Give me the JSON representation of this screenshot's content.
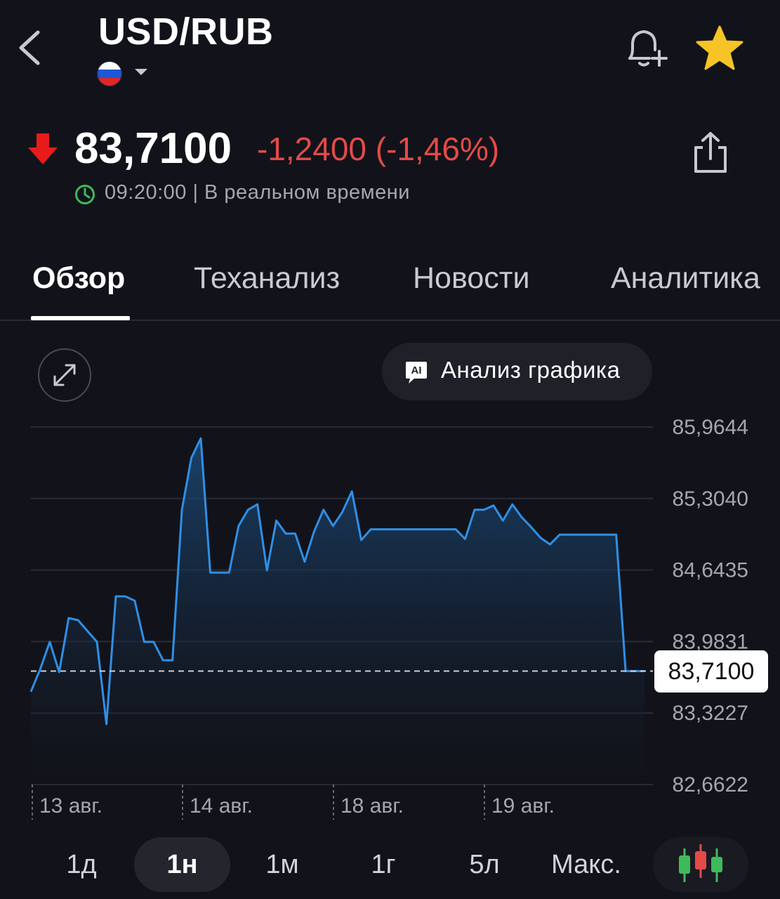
{
  "header": {
    "pair": "USD/RUB",
    "flag_colors": [
      "#ffffff",
      "#1c57d6",
      "#e1262a"
    ],
    "icons": [
      "back-chevron-icon",
      "bell-plus-icon",
      "star-icon"
    ],
    "star_color": "#f6c426"
  },
  "quote": {
    "price": "83,7100",
    "change": "-1,2400 (-1,46%)",
    "direction": "down",
    "down_color": "#e34b48",
    "arrow_color": "#e81b1b",
    "time_status": "09:20:00 | В реальном времени",
    "clock_color": "#3fba5b"
  },
  "tabs": [
    {
      "label": "Обзор",
      "active": true
    },
    {
      "label": "Теханализ",
      "active": false
    },
    {
      "label": "Новости",
      "active": false
    },
    {
      "label": "Аналитика",
      "active": false
    }
  ],
  "chart_controls": {
    "ai_label": "Анализ графика",
    "ai_icon_text": "AI"
  },
  "chart_data": {
    "type": "area",
    "y_ticks": [
      "85,9644",
      "85,3040",
      "84,6435",
      "83,9831",
      "83,3227",
      "82,6622"
    ],
    "y_tick_values": [
      85.9644,
      85.304,
      84.6435,
      83.9831,
      83.3227,
      82.6622
    ],
    "ylim": [
      82.6622,
      85.9644
    ],
    "x_ticks": [
      "13 авг.",
      "14 авг.",
      "18 авг.",
      "19 авг."
    ],
    "current_value": 83.71,
    "current_label": "83,7100",
    "line_color": "#2f8fe6",
    "grid": true,
    "values": [
      83.52,
      83.73,
      83.98,
      83.7,
      84.2,
      84.18,
      84.08,
      83.98,
      83.22,
      84.4,
      84.4,
      84.36,
      83.98,
      83.98,
      83.81,
      83.81,
      85.2,
      85.68,
      85.86,
      84.62,
      84.62,
      84.62,
      85.05,
      85.2,
      85.25,
      84.64,
      85.1,
      84.98,
      84.98,
      84.72,
      85.0,
      85.2,
      85.05,
      85.18,
      85.37,
      84.92,
      85.02,
      85.02,
      85.02,
      85.02,
      85.02,
      85.02,
      85.02,
      85.02,
      85.02,
      85.02,
      84.93,
      85.2,
      85.2,
      85.24,
      85.1,
      85.25,
      85.13,
      85.04,
      84.94,
      84.88,
      84.97,
      84.97,
      84.97,
      84.97,
      84.97,
      84.97,
      84.97,
      83.71,
      83.71,
      83.71
    ]
  },
  "ranges": [
    {
      "label": "1д",
      "active": false
    },
    {
      "label": "1н",
      "active": true
    },
    {
      "label": "1м",
      "active": false
    },
    {
      "label": "1г",
      "active": false
    },
    {
      "label": "5л",
      "active": false
    },
    {
      "label": "Макс.",
      "active": false
    }
  ]
}
